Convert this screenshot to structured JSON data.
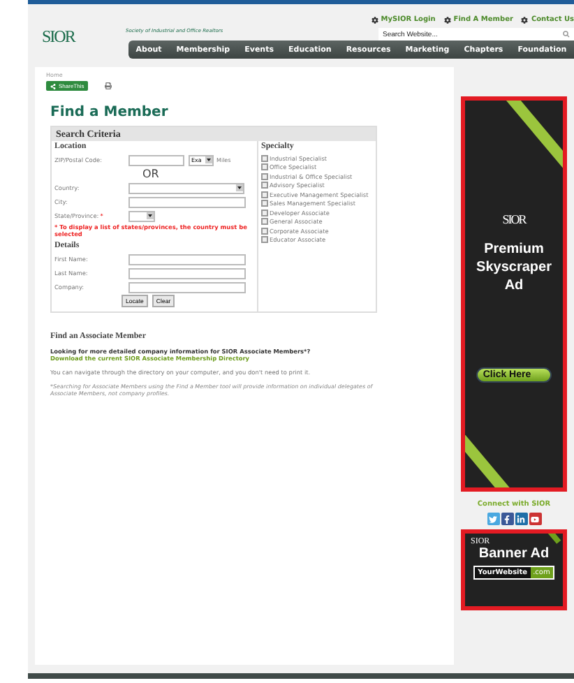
{
  "header": {
    "logo_text": "SIOR",
    "tagline": "Society of Industrial and Office Realtors",
    "top_links": [
      "MySIOR Login",
      "Find A Member",
      "Contact Us"
    ],
    "search": {
      "placeholder": "Search Website..."
    },
    "nav": [
      "About",
      "Membership",
      "Events",
      "Education",
      "Resources",
      "Marketing",
      "Chapters",
      "Foundation"
    ]
  },
  "breadcrumb": "Home",
  "share_button": "ShareThis",
  "title": "Find a Member",
  "search_criteria": {
    "title": "Search Criteria",
    "location": {
      "heading": "Location",
      "zip_label": "ZIP/Postal Code:",
      "distance_value": "Exa",
      "distance_unit": "Miles",
      "or": "OR",
      "country_label": "Country:",
      "city_label": "City:",
      "state_label": "State/Province:",
      "required_mark": "*",
      "note": "* To display a list of states/provinces, the country must be selected"
    },
    "details": {
      "heading": "Details",
      "fields": [
        "First Name:",
        "Last Name:",
        "Company:"
      ]
    },
    "buttons": [
      "Locate",
      "Clear"
    ],
    "specialty": {
      "heading": "Specialty",
      "items": [
        {
          "label": "Industrial Specialist",
          "checked": false
        },
        {
          "label": "Office Specialist",
          "checked": false
        },
        {
          "label": "Industrial & Office Specialist",
          "checked": false
        },
        {
          "label": "Advisory Specialist",
          "checked": false
        },
        {
          "label": "Executive Management Specialist",
          "checked": false
        },
        {
          "label": "Sales Management Specialist",
          "checked": false
        },
        {
          "label": "Developer Associate",
          "checked": false
        },
        {
          "label": "General Associate",
          "checked": false
        },
        {
          "label": "Corporate Associate",
          "checked": false
        },
        {
          "label": "Educator Associate",
          "checked": false
        }
      ]
    }
  },
  "associate": {
    "heading": "Find an Associate Member",
    "question": "Looking for more detailed company information for SIOR Associate Members*?",
    "link": "Download the current SIOR Associate Membership Directory",
    "text": "You can navigate through the directory on your computer, and you don't need to print it.",
    "footnote": "*Searching for Associate Members using the Find a Member tool will provide information on individual delegates of Associate Members, not company profiles."
  },
  "sidebar": {
    "skyscraper_ad": {
      "logo_text": "SIOR",
      "lines": [
        "Premium",
        "Skyscraper",
        "Ad"
      ],
      "button": "Click Here"
    },
    "connect_heading": "Connect with SIOR",
    "social": [
      {
        "kind": "twitter"
      },
      {
        "kind": "facebook"
      },
      {
        "kind": "linkedin"
      },
      {
        "kind": "youtube"
      }
    ],
    "banner_ad": {
      "logo_text": "SIOR",
      "title": "Banner Ad",
      "site": "YourWebsite",
      "tld": ".com"
    }
  }
}
